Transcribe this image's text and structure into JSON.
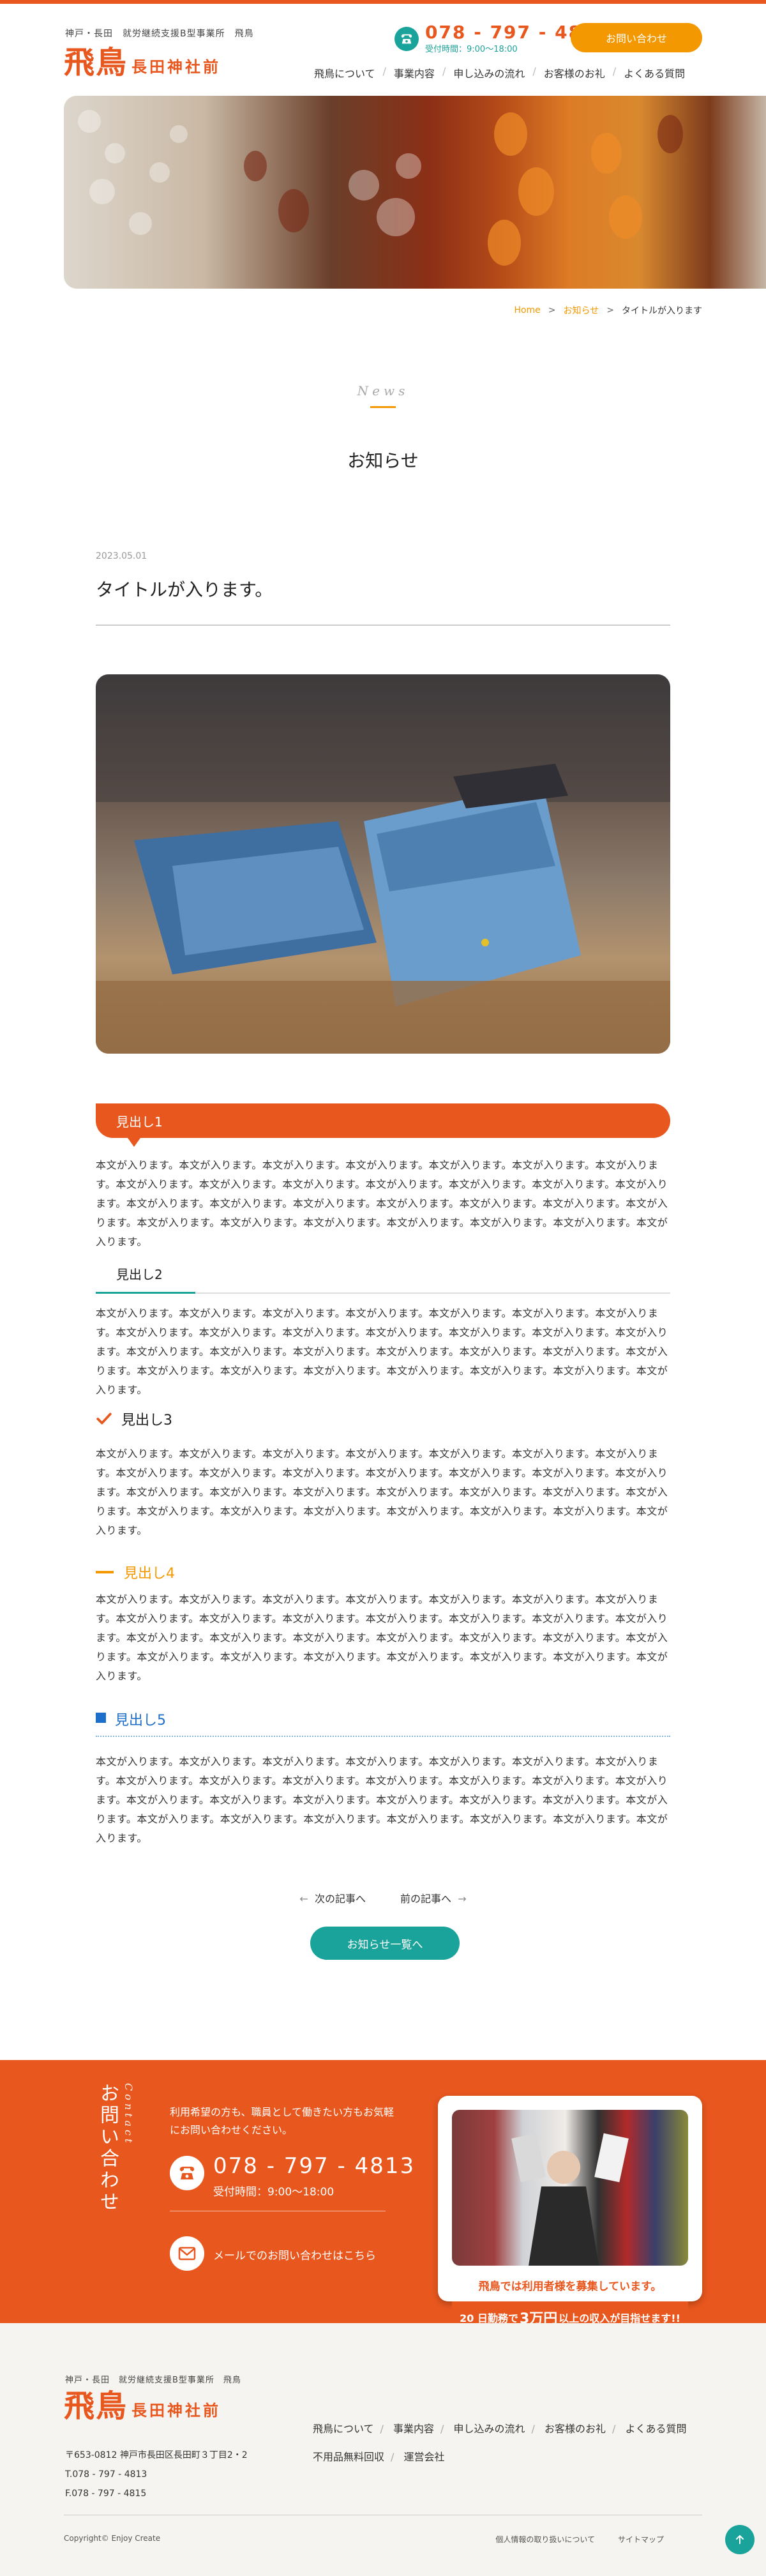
{
  "header": {
    "tagline": "神戸・長田　就労継続支援B型事業所　飛鳥",
    "logo_main": "飛鳥",
    "logo_sub": "長田神社前",
    "tel_number": "078 - 797 - 4813",
    "tel_hours": "受付時間：9:00〜18:00",
    "contact_button": "お問い合わせ",
    "nav": [
      "飛鳥について",
      "事業内容",
      "申し込みの流れ",
      "お客様のお礼",
      "よくある質問"
    ]
  },
  "breadcrumb": {
    "home": "Home",
    "news": "お知らせ",
    "current": "タイトルが入ります"
  },
  "page": {
    "en_label": "News",
    "title": "お知らせ"
  },
  "article": {
    "date": "2023.05.01",
    "title": "タイトルが入ります。",
    "h1": "見出し1",
    "h2": "見出し2",
    "h3": "見出し3",
    "h4": "見出し4",
    "h5": "見出し5",
    "body_text": "本文が入ります。本文が入ります。本文が入ります。本文が入ります。本文が入ります。本文が入ります。本文が入ります。本文が入ります。本文が入ります。本文が入ります。本文が入ります。本文が入ります。本文が入ります。本文が入ります。本文が入ります。本文が入ります。本文が入ります。本文が入ります。本文が入ります。本文が入ります。本文が入ります。本文が入ります。本文が入ります。本文が入ります。本文が入ります。本文が入ります。本文が入ります。本文が入ります。"
  },
  "pager": {
    "next": "次の記事へ",
    "prev": "前の記事へ",
    "list_button": "お知らせ一覧へ"
  },
  "contact": {
    "vertical_title": "お問い合わせ",
    "vertical_en": "Contact",
    "lead": "利用希望の方も、職員として働きたい方もお気軽にお問い合わせください。",
    "tel": "078 - 797 - 4813",
    "hours": "受付時間：9:00〜18:00",
    "mail": "メールでのお問い合わせはこちら",
    "recruit_title": "飛鳥では利用者様を募集しています。",
    "recruit_bar_pre": "20 日勤務で",
    "recruit_bar_big": "3万円",
    "recruit_bar_post": "以上の収入が目指せます!!"
  },
  "footer": {
    "tagline": "神戸・長田　就労継続支援B型事業所　飛鳥",
    "logo_main": "飛鳥",
    "logo_sub": "長田神社前",
    "address_lines": [
      "〒653-0812 神戸市長田区長田町３丁目2・2",
      "T.078 - 797 - 4813",
      "F.078 - 797 - 4815"
    ],
    "nav_row1": [
      "飛鳥について",
      "事業内容",
      "申し込みの流れ",
      "お客様のお礼",
      "よくある質問"
    ],
    "nav_row2": [
      "不用品無料回収",
      "運営会社"
    ],
    "copyright": "Copyright© Enjoy Create",
    "privacy": "個人情報の取り扱いについて",
    "sitemap": "サイトマップ"
  },
  "colors": {
    "orange": "#e8571e",
    "amber": "#f39800",
    "teal": "#1aa39a",
    "blue": "#1d6fc9"
  }
}
